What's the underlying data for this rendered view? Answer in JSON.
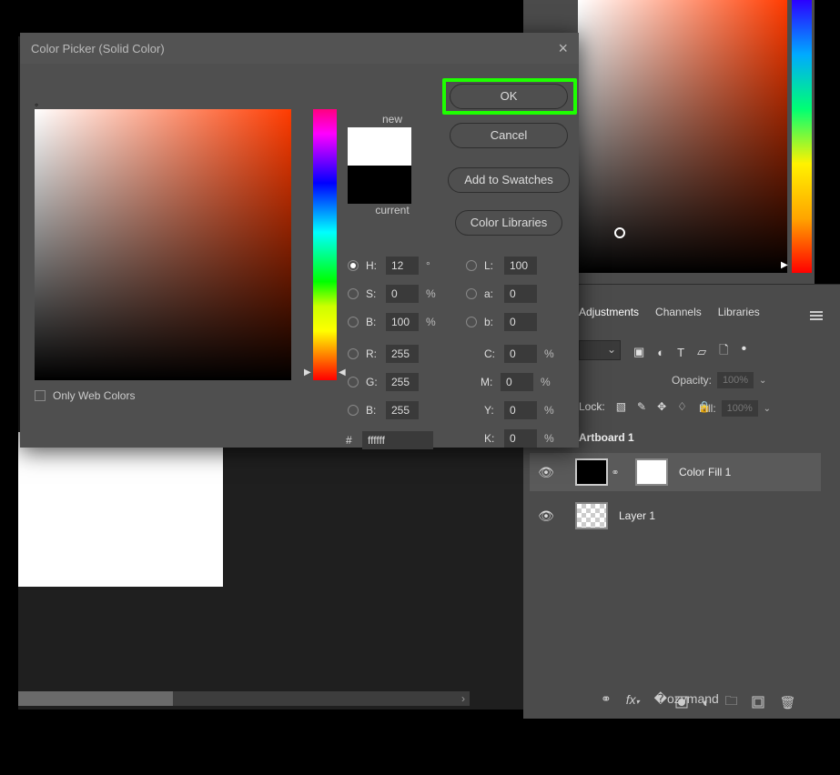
{
  "dialog": {
    "title": "Color Picker (Solid Color)",
    "new_label": "new",
    "current_label": "current",
    "ok": "OK",
    "cancel": "Cancel",
    "add_swatches": "Add to Swatches",
    "color_libraries": "Color Libraries",
    "only_web": "Only Web Colors",
    "fields": {
      "h": {
        "label": "H:",
        "value": "12",
        "unit": "°"
      },
      "s": {
        "label": "S:",
        "value": "0",
        "unit": "%"
      },
      "bhsb": {
        "label": "B:",
        "value": "100",
        "unit": "%"
      },
      "r": {
        "label": "R:",
        "value": "255"
      },
      "g": {
        "label": "G:",
        "value": "255"
      },
      "brgb": {
        "label": "B:",
        "value": "255"
      },
      "l": {
        "label": "L:",
        "value": "100"
      },
      "a": {
        "label": "a:",
        "value": "0"
      },
      "blab": {
        "label": "b:",
        "value": "0"
      },
      "c": {
        "label": "C:",
        "value": "0",
        "unit": "%"
      },
      "m": {
        "label": "M:",
        "value": "0",
        "unit": "%"
      },
      "y": {
        "label": "Y:",
        "value": "0",
        "unit": "%"
      },
      "k": {
        "label": "K:",
        "value": "0",
        "unit": "%"
      },
      "hex": {
        "label": "#",
        "value": "ffffff"
      }
    }
  },
  "side": {
    "tabs": {
      "adjustments": "Adjustments",
      "channels": "Channels",
      "libraries": "Libraries"
    },
    "opacity_label": "Opacity:",
    "opacity_value": "100%",
    "fill_label": "Fill:",
    "fill_value": "100%",
    "lock_label": "Lock:",
    "artboard": "Artboard 1",
    "layers": {
      "colorfill": "Color Fill 1",
      "layer1": "Layer 1"
    }
  }
}
